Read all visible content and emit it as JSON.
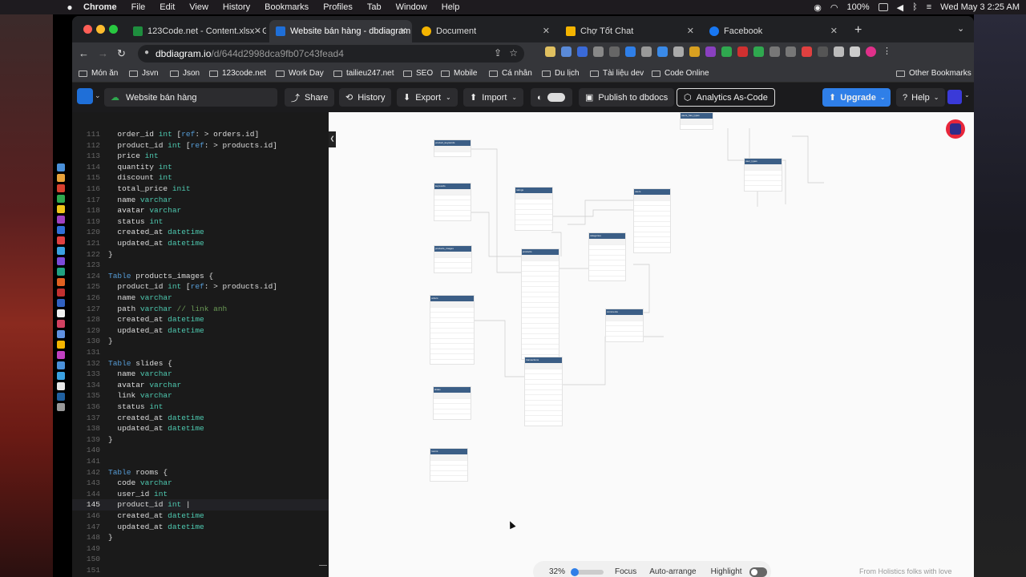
{
  "menubar": {
    "app": "Chrome",
    "items": [
      "File",
      "Edit",
      "View",
      "History",
      "Bookmarks",
      "Profiles",
      "Tab",
      "Window",
      "Help"
    ],
    "battery": "100%",
    "datetime": "Wed May 3  2:25 AM"
  },
  "tabs": [
    {
      "title": "123Code.net - Content.xlsx - G",
      "favicon": "#1e8e3e",
      "active": false
    },
    {
      "title": "Website bán hàng - dbdiagram",
      "favicon": "#1f6fd8",
      "active": true
    },
    {
      "title": "Document",
      "favicon": "#f4b400",
      "active": false
    },
    {
      "title": "Chợ Tốt Chat",
      "favicon": "#f4b400",
      "active": false
    },
    {
      "title": "Facebook",
      "favicon": "#1877f2",
      "active": false
    }
  ],
  "address": {
    "host": "dbdiagram.io",
    "path": "/d/644d2998dca9fb07c43fead4"
  },
  "bookmarks": [
    "Món ăn",
    "Jsvn",
    "Json",
    "123code.net",
    "Work Day",
    "tailieu247.net",
    "SEO",
    "Mobile",
    "Cá nhân",
    "Du lịch",
    "Tài liệu dev",
    "Code Online",
    "Other Bookmarks"
  ],
  "app": {
    "doc_title": "Website bán hàng",
    "share": "Share",
    "history": "History",
    "export": "Export",
    "import": "Import",
    "publish": "Publish to dbdocs",
    "analytics": "Analytics As-Code",
    "upgrade": "Upgrade",
    "help": "Help"
  },
  "code": [
    {
      "n": "111",
      "t": "  order_id int [ref: > orders.id]"
    },
    {
      "n": "112",
      "t": "  product_id int [ref: > products.id]"
    },
    {
      "n": "113",
      "t": "  price int"
    },
    {
      "n": "114",
      "t": "  quantity int"
    },
    {
      "n": "115",
      "t": "  discount int"
    },
    {
      "n": "116",
      "t": "  total_price init"
    },
    {
      "n": "117",
      "t": "  name varchar"
    },
    {
      "n": "118",
      "t": "  avatar varchar"
    },
    {
      "n": "119",
      "t": "  status int"
    },
    {
      "n": "120",
      "t": "  created_at datetime"
    },
    {
      "n": "121",
      "t": "  updated_at datetime"
    },
    {
      "n": "122",
      "t": "}"
    },
    {
      "n": "123",
      "t": ""
    },
    {
      "n": "124",
      "t": "Table products_images {"
    },
    {
      "n": "125",
      "t": "  product_id int [ref: > products.id]"
    },
    {
      "n": "126",
      "t": "  name varchar"
    },
    {
      "n": "127",
      "t": "  path varchar // link anh"
    },
    {
      "n": "128",
      "t": "  created_at datetime"
    },
    {
      "n": "129",
      "t": "  updated_at datetime"
    },
    {
      "n": "130",
      "t": "}"
    },
    {
      "n": "131",
      "t": ""
    },
    {
      "n": "132",
      "t": "Table slides {"
    },
    {
      "n": "133",
      "t": "  name varchar"
    },
    {
      "n": "134",
      "t": "  avatar varchar"
    },
    {
      "n": "135",
      "t": "  link varchar"
    },
    {
      "n": "136",
      "t": "  status int"
    },
    {
      "n": "137",
      "t": "  created_at datetime"
    },
    {
      "n": "138",
      "t": "  updated_at datetime"
    },
    {
      "n": "139",
      "t": "}"
    },
    {
      "n": "140",
      "t": ""
    },
    {
      "n": "141",
      "t": ""
    },
    {
      "n": "142",
      "t": "Table rooms {"
    },
    {
      "n": "143",
      "t": "  code varchar"
    },
    {
      "n": "144",
      "t": "  user_id int"
    },
    {
      "n": "145",
      "t": "  product_id int |"
    },
    {
      "n": "146",
      "t": "  created_at datetime"
    },
    {
      "n": "147",
      "t": "  updated_at datetime"
    },
    {
      "n": "148",
      "t": "}"
    },
    {
      "n": "149",
      "t": ""
    },
    {
      "n": "150",
      "t": ""
    },
    {
      "n": "151",
      "t": ""
    },
    {
      "n": "152",
      "t": ""
    }
  ],
  "current_line": "145",
  "diagram_tables": [
    {
      "name": "product_keywords",
      "rows": 2
    },
    {
      "name": "keywords",
      "rows": 6
    },
    {
      "name": "products_images",
      "rows": 4
    },
    {
      "name": "orders",
      "rows": 12
    },
    {
      "name": "slides",
      "rows": 5
    },
    {
      "name": "rooms",
      "rows": 5
    },
    {
      "name": "ratings",
      "rows": 7
    },
    {
      "name": "products",
      "rows": 20
    },
    {
      "name": "transactions",
      "rows": 12
    },
    {
      "name": "categories",
      "rows": 8
    },
    {
      "name": "comments",
      "rows": 5
    },
    {
      "name": "users",
      "rows": 11
    },
    {
      "name": "users_has_types",
      "rows": 2
    },
    {
      "name": "user_types",
      "rows": 5
    }
  ],
  "zoom": {
    "level": "32%",
    "fraction": 0.32,
    "focus": "Focus",
    "auto_arrange": "Auto-arrange",
    "highlight": "Highlight"
  },
  "footer": "From Holistics folks with love"
}
